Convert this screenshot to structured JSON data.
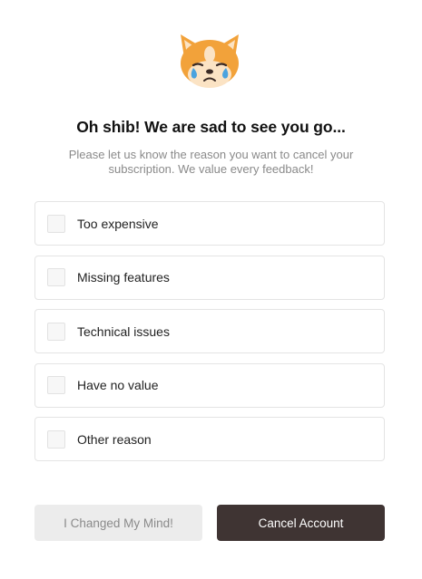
{
  "mascot": {
    "icon": "crying-shiba-icon"
  },
  "title": "Oh shib! We are sad to see you go...",
  "subtitle": "Please let us know the reason you want to cancel your subscription. We value every feedback!",
  "reasons": [
    {
      "label": "Too expensive",
      "checked": false
    },
    {
      "label": "Missing features",
      "checked": false
    },
    {
      "label": "Technical issues",
      "checked": false
    },
    {
      "label": "Have no value",
      "checked": false
    },
    {
      "label": "Other reason",
      "checked": false
    }
  ],
  "buttons": {
    "keep_label": "I Changed My Mind!",
    "cancel_label": "Cancel Account"
  },
  "colors": {
    "cancel_button_bg": "#3f3433",
    "keep_button_bg": "#ececec",
    "mascot_orange": "#f2a23a"
  }
}
